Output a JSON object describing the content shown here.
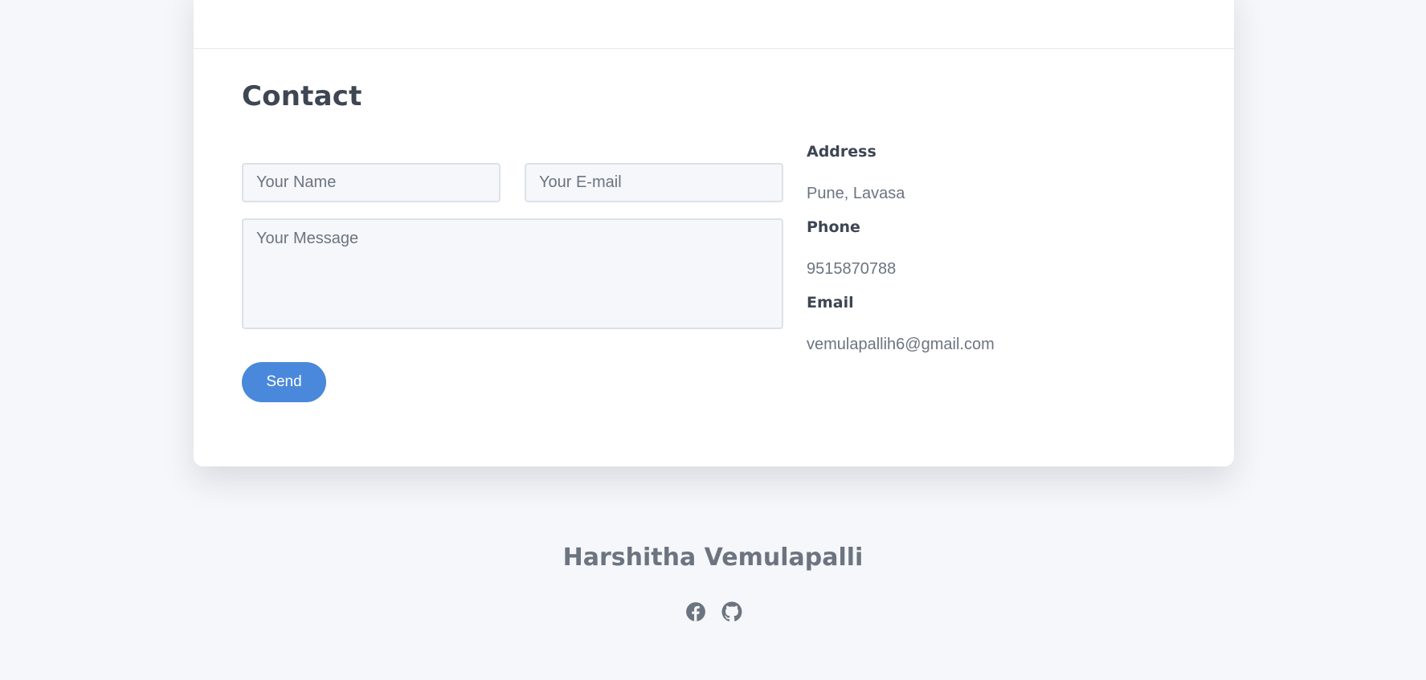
{
  "contact": {
    "title": "Contact",
    "form": {
      "name_placeholder": "Your Name",
      "email_placeholder": "Your E-mail",
      "message_placeholder": "Your Message",
      "send_label": "Send"
    },
    "info": {
      "address_label": "Address",
      "address_value": "Pune, Lavasa",
      "phone_label": "Phone",
      "phone_value": "9515870788",
      "email_label": "Email",
      "email_value": "vemulapallih6@gmail.com"
    }
  },
  "footer": {
    "name": "Harshitha Vemulapalli",
    "social": [
      {
        "icon": "facebook-icon"
      },
      {
        "icon": "github-icon"
      }
    ]
  },
  "colors": {
    "background": "#f5f7fa",
    "card": "#ffffff",
    "heading": "#3e4553",
    "text": "#6c7480",
    "accent": "#4a88db"
  }
}
